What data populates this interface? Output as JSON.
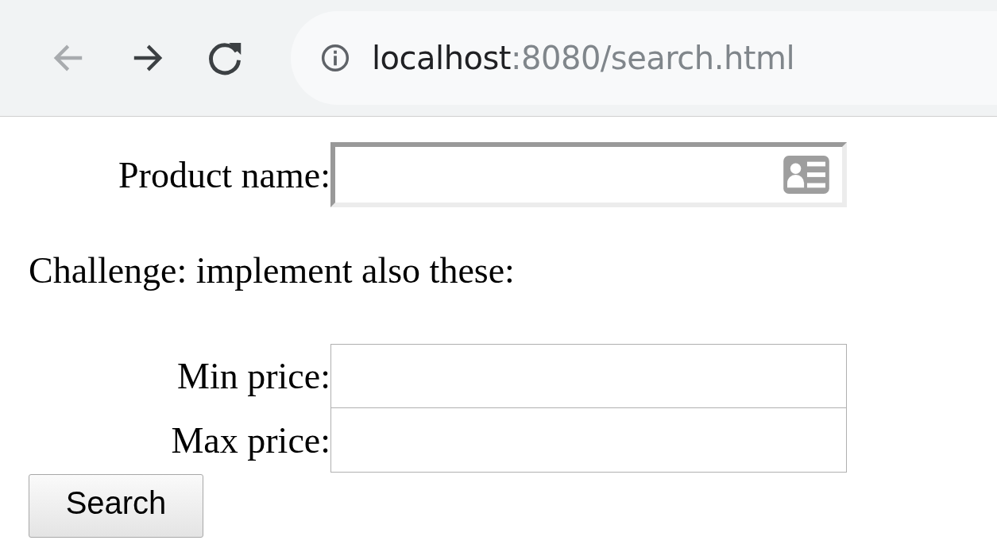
{
  "browser": {
    "back_disabled": true,
    "url_host": "localhost",
    "url_path": ":8080/search.html"
  },
  "product_field": {
    "label": "Product name:",
    "kind": "contact"
  },
  "note": "Challenge: implement also these:",
  "price_fields": [
    {
      "label": "Min price:",
      "kind": "plain"
    },
    {
      "label": "Max price:",
      "kind": "plain"
    }
  ],
  "button": "Search"
}
